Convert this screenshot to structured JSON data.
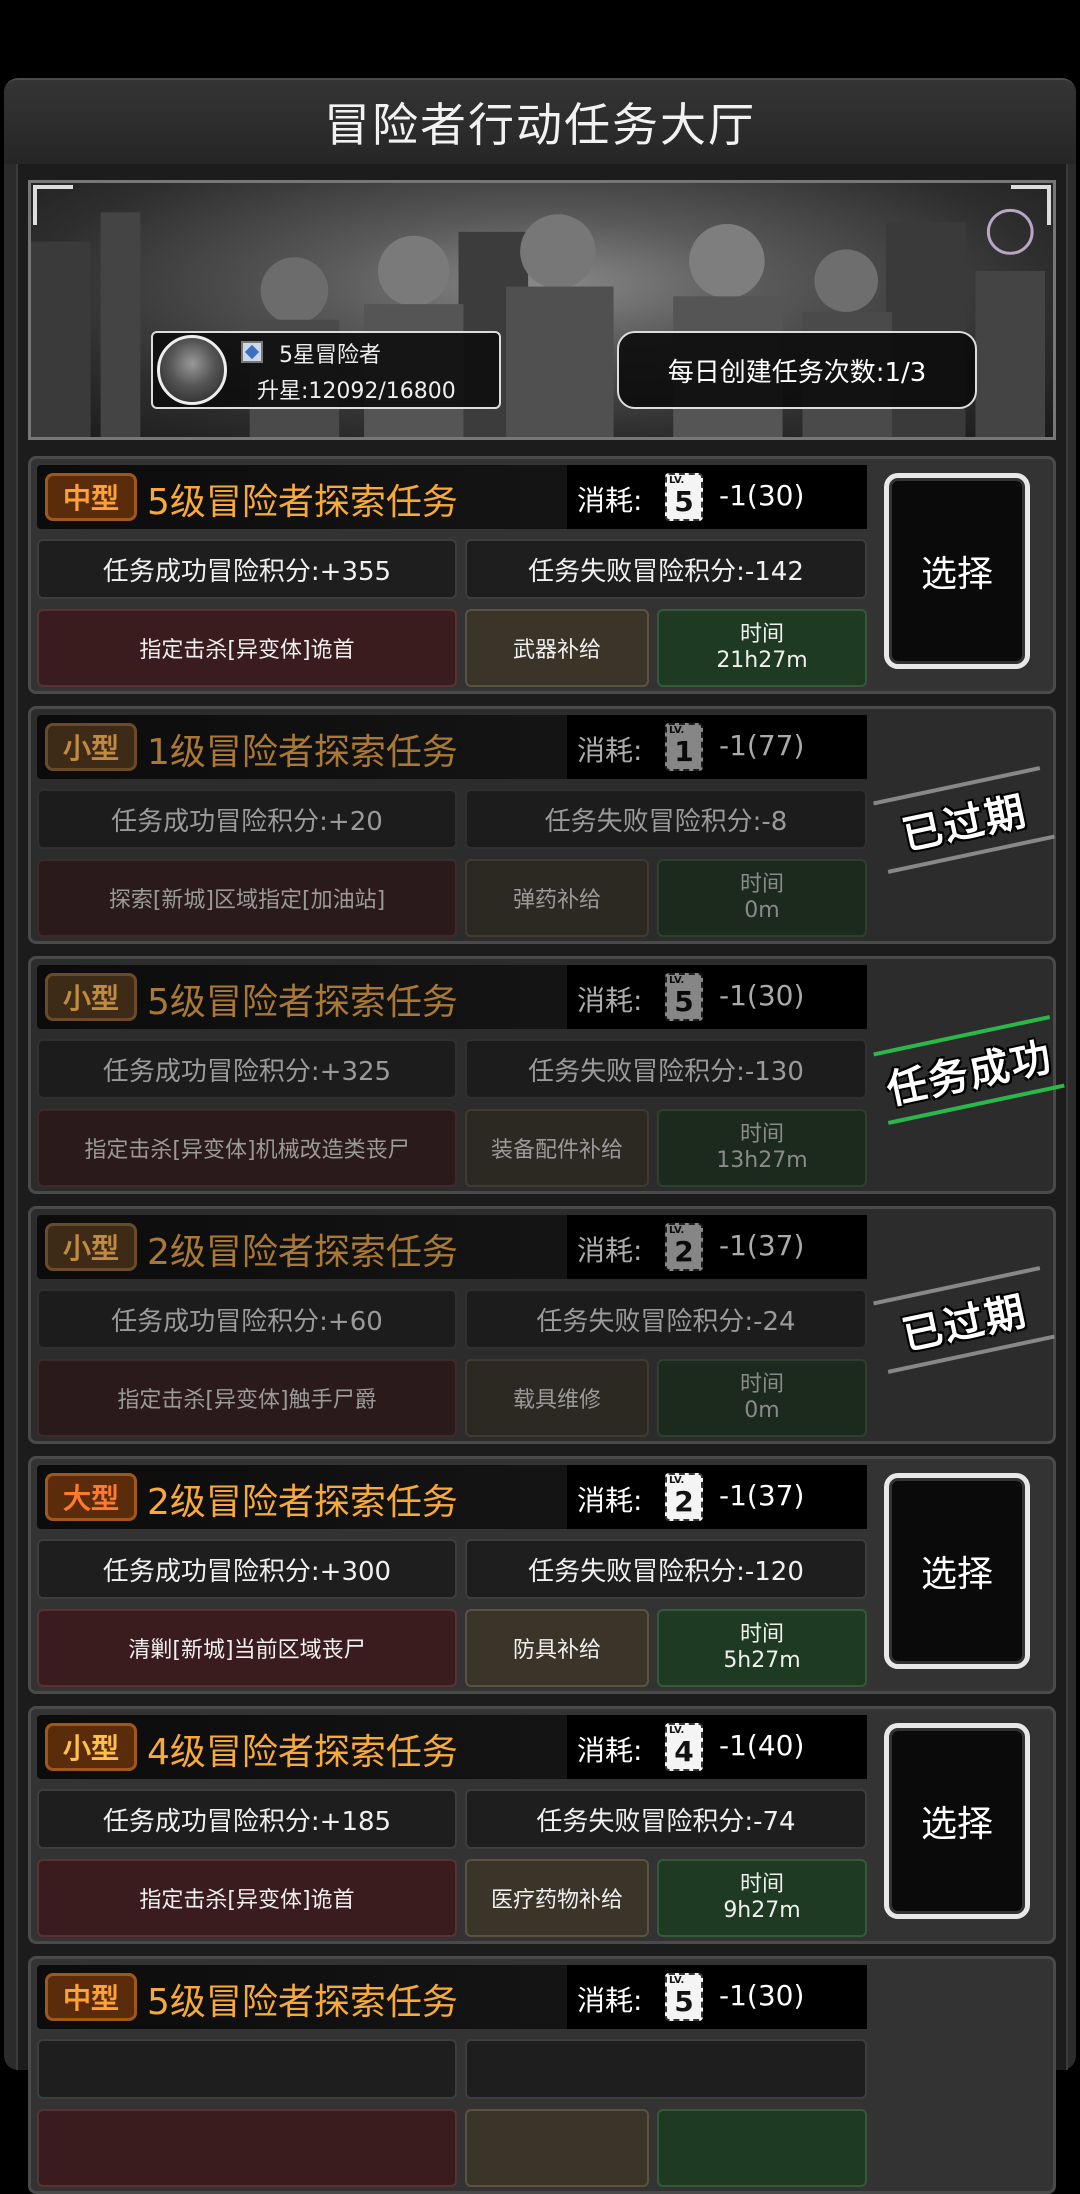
{
  "window": {
    "title": "冒险者行动任务大厅"
  },
  "player": {
    "rank": "5星冒险者",
    "stars": "升星:12092/16800"
  },
  "daily": {
    "label": "每日创建任务次数:1/3"
  },
  "labels": {
    "cost": "消耗:",
    "time": "时间",
    "select": "选择",
    "lv": "LV."
  },
  "missions": [
    {
      "size": "中型",
      "title": "5级冒险者探索任务",
      "lv": "5",
      "cost": "-1(30)",
      "success": "任务成功冒险积分:+355",
      "fail": "任务失败冒险积分:-142",
      "requirement": "指定击杀[异变体]诡首",
      "reward": "武器补给",
      "time": "21h27m",
      "state": "select",
      "stamp": ""
    },
    {
      "size": "小型",
      "title": "1级冒险者探索任务",
      "lv": "1",
      "cost": "-1(77)",
      "success": "任务成功冒险积分:+20",
      "fail": "任务失败冒险积分:-8",
      "requirement": "探索[新城]区域指定[加油站]",
      "reward": "弹药补给",
      "time": "0m",
      "state": "expired",
      "stamp": "已过期"
    },
    {
      "size": "小型",
      "title": "5级冒险者探索任务",
      "lv": "5",
      "cost": "-1(30)",
      "success": "任务成功冒险积分:+325",
      "fail": "任务失败冒险积分:-130",
      "requirement": "指定击杀[异变体]机械改造类丧尸",
      "reward": "装备配件补给",
      "time": "13h27m",
      "state": "success",
      "stamp": "任务成功"
    },
    {
      "size": "小型",
      "title": "2级冒险者探索任务",
      "lv": "2",
      "cost": "-1(37)",
      "success": "任务成功冒险积分:+60",
      "fail": "任务失败冒险积分:-24",
      "requirement": "指定击杀[异变体]触手尸爵",
      "reward": "载具维修",
      "time": "0m",
      "state": "expired",
      "stamp": "已过期"
    },
    {
      "size": "大型",
      "title": "2级冒险者探索任务",
      "lv": "2",
      "cost": "-1(37)",
      "success": "任务成功冒险积分:+300",
      "fail": "任务失败冒险积分:-120",
      "requirement": "清剿[新城]当前区域丧尸",
      "reward": "防具补给",
      "time": "5h27m",
      "state": "select",
      "stamp": ""
    },
    {
      "size": "小型",
      "title": "4级冒险者探索任务",
      "lv": "4",
      "cost": "-1(40)",
      "success": "任务成功冒险积分:+185",
      "fail": "任务失败冒险积分:-74",
      "requirement": "指定击杀[异变体]诡首",
      "reward": "医疗药物补给",
      "time": "9h27m",
      "state": "select",
      "stamp": ""
    },
    {
      "size": "中型",
      "title": "5级冒险者探索任务",
      "lv": "5",
      "cost": "-1(30)",
      "success": "",
      "fail": "",
      "requirement": "",
      "reward": "",
      "time": "",
      "state": "partial",
      "stamp": ""
    }
  ],
  "colors": {
    "accent": "#f7a93a",
    "success_stamp": "#2bb84a"
  }
}
